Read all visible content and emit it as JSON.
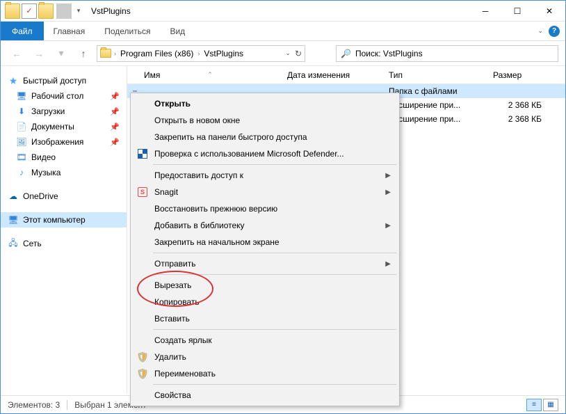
{
  "window": {
    "title": "VstPlugins"
  },
  "ribbon": {
    "file": "Файл",
    "tabs": [
      "Главная",
      "Поделиться",
      "Вид"
    ]
  },
  "address": {
    "crumbs": [
      "Program Files (x86)",
      "VstPlugins"
    ]
  },
  "search": {
    "placeholder": "Поиск: VstPlugins"
  },
  "sidebar": {
    "quick": {
      "label": "Быстрый доступ",
      "items": [
        {
          "label": "Рабочий стол",
          "pin": true
        },
        {
          "label": "Загрузки",
          "pin": true
        },
        {
          "label": "Документы",
          "pin": true
        },
        {
          "label": "Изображения",
          "pin": true
        },
        {
          "label": "Видео",
          "pin": false
        },
        {
          "label": "Музыка",
          "pin": false
        }
      ]
    },
    "onedrive": "OneDrive",
    "thispc": "Этот компьютер",
    "network": "Сеть"
  },
  "columns": {
    "name": "Имя",
    "date": "Дата изменения",
    "type": "Тип",
    "size": "Размер"
  },
  "rows": [
    {
      "name": "",
      "date": "",
      "type": "Папка с файлами",
      "size": "",
      "sel": true
    },
    {
      "name": "",
      "date": "",
      "type": "Расширение при...",
      "size": "2 368 КБ"
    },
    {
      "name": "",
      "date": "",
      "type": "Расширение при...",
      "size": "2 368 КБ"
    }
  ],
  "ctx": {
    "open": "Открыть",
    "open_new": "Открыть в новом окне",
    "pin_quick": "Закрепить на панели быстрого доступа",
    "defender": "Проверка с использованием Microsoft Defender...",
    "grant": "Предоставить доступ к",
    "snagit": "Snagit",
    "restore": "Восстановить прежнюю версию",
    "library": "Добавить в библиотеку",
    "pin_start": "Закрепить на начальном экране",
    "send": "Отправить",
    "cut": "Вырезать",
    "copy": "Копировать",
    "paste": "Вставить",
    "shortcut": "Создать ярлык",
    "delete": "Удалить",
    "rename": "Переименовать",
    "props": "Свойства"
  },
  "status": {
    "count": "Элементов: 3",
    "sel": "Выбран 1 элемент"
  }
}
